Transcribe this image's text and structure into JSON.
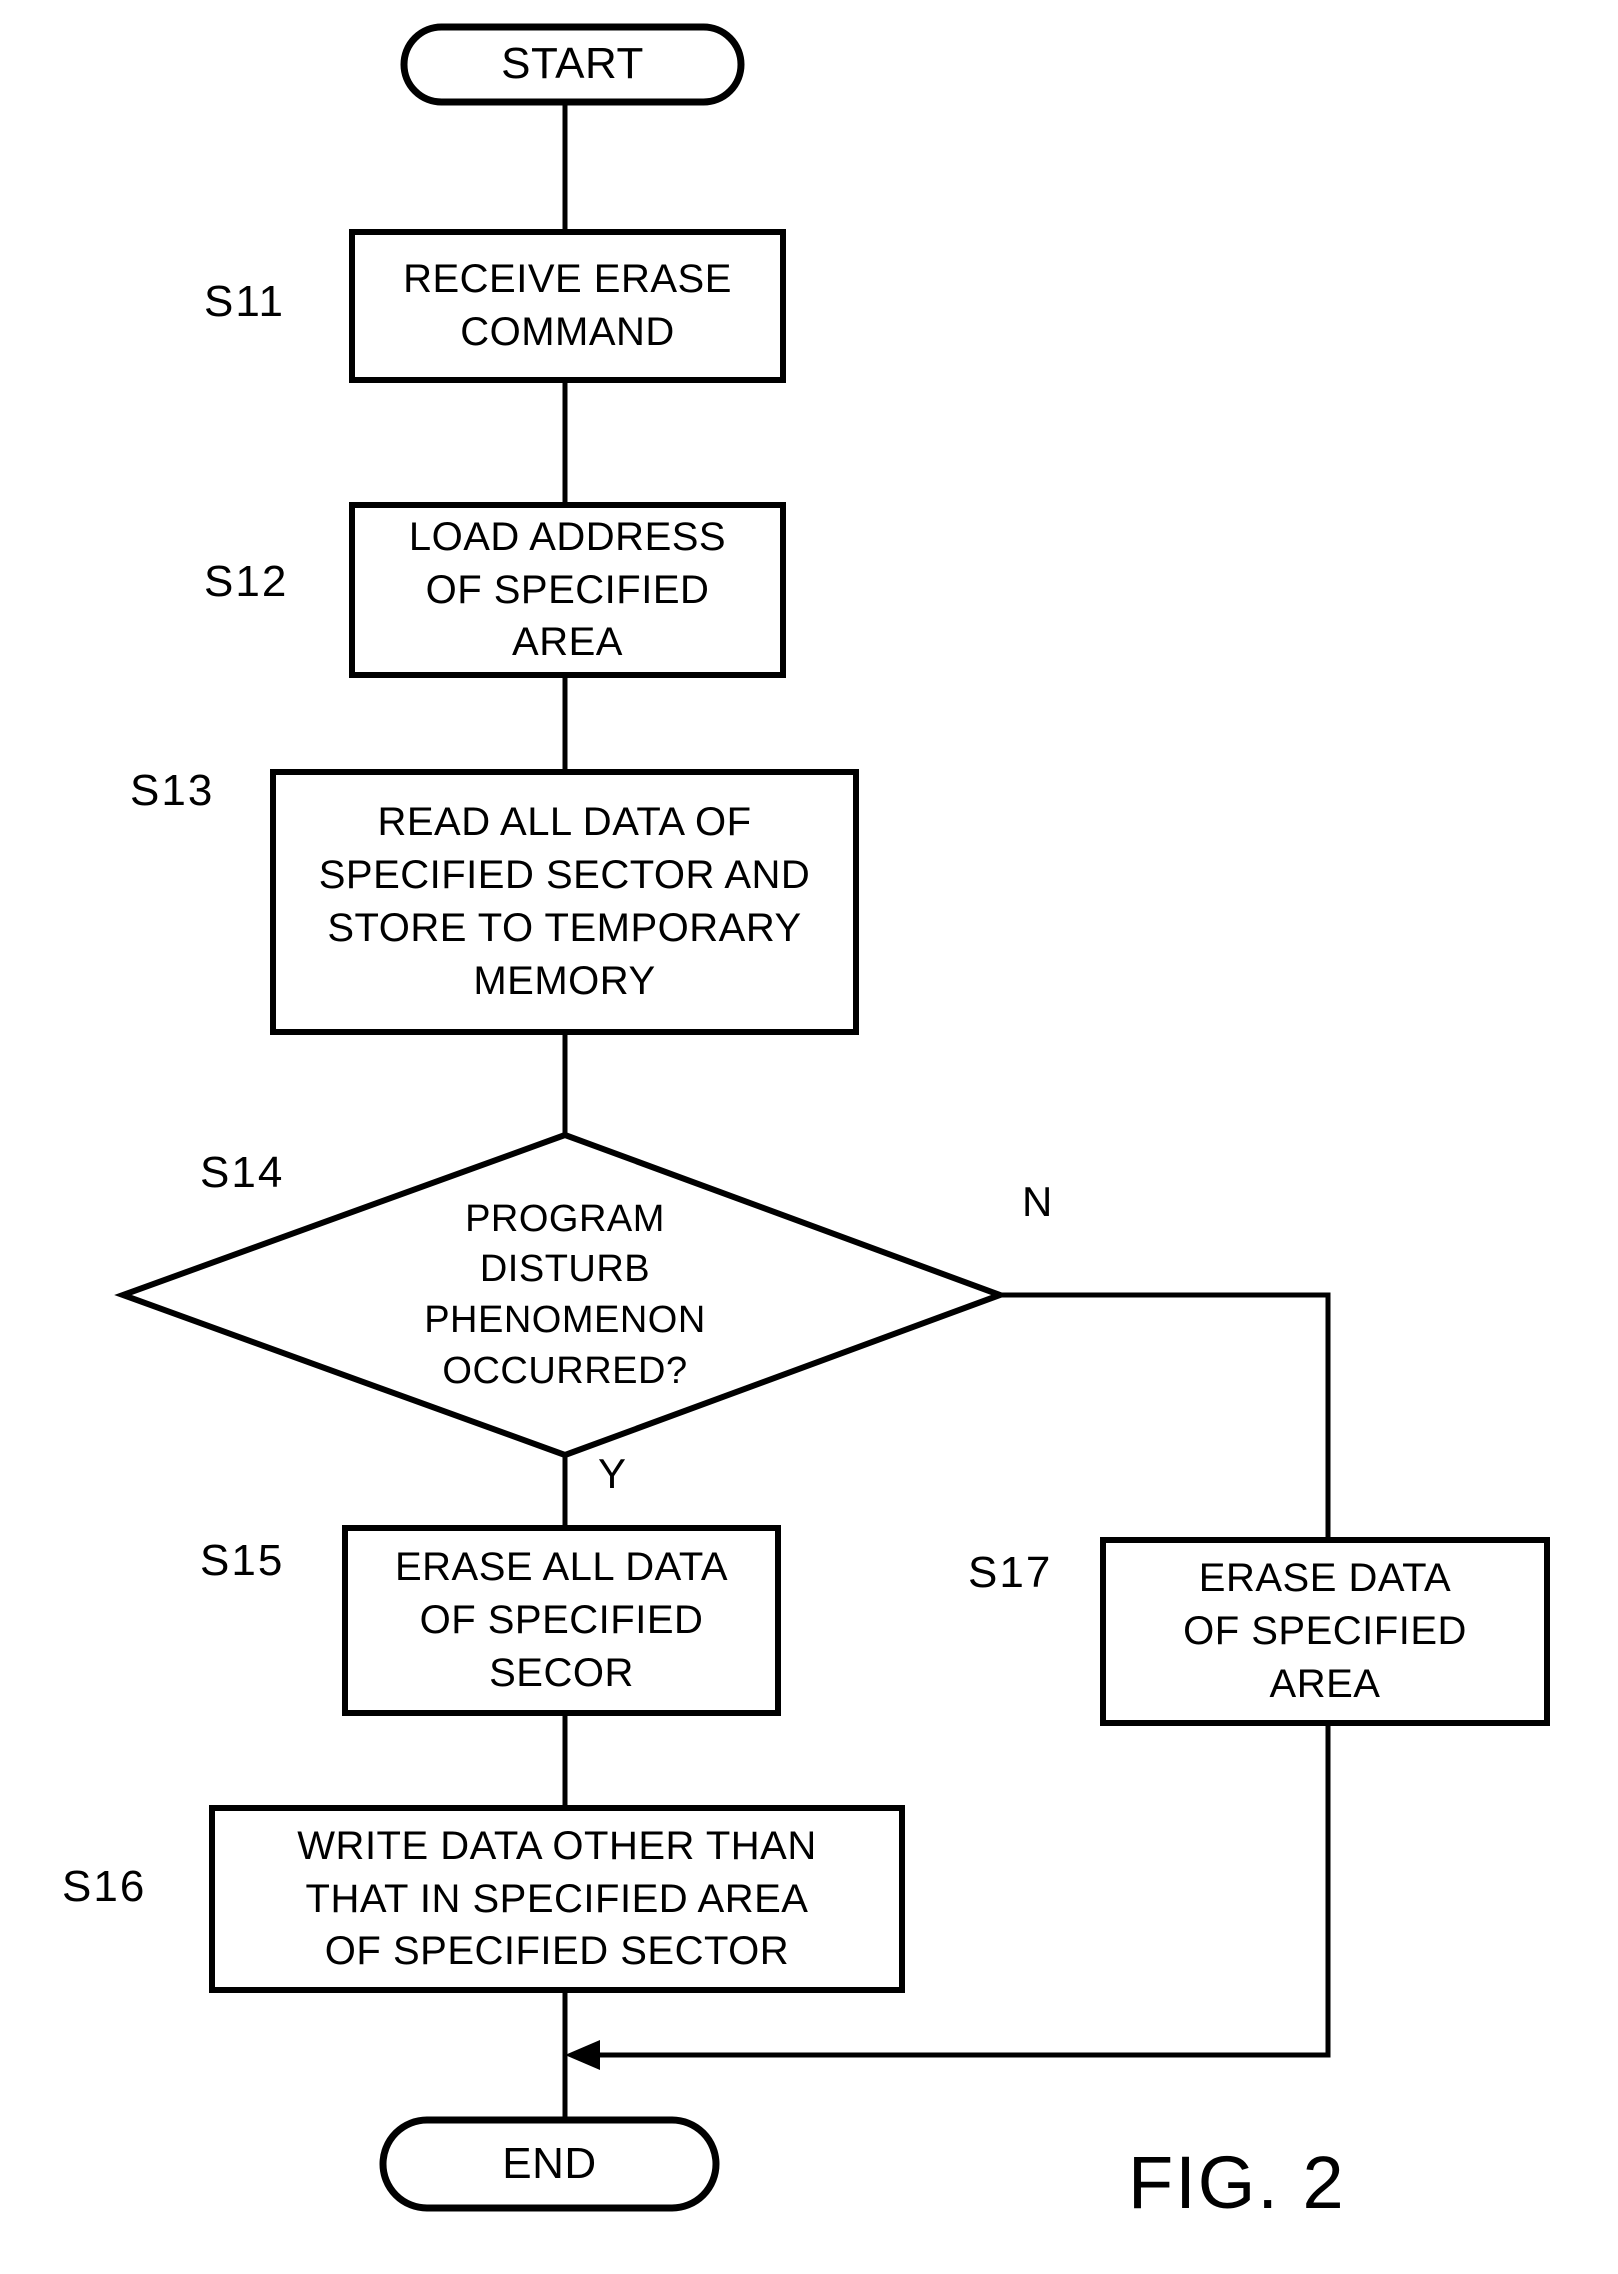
{
  "figure": {
    "caption": "FIG. 2",
    "type": "flowchart"
  },
  "nodes": {
    "start": {
      "label": "START",
      "shape": "terminal"
    },
    "end": {
      "label": "END",
      "shape": "terminal"
    },
    "s11": {
      "step": "S11",
      "shape": "process",
      "lines": [
        "RECEIVE ERASE",
        "COMMAND"
      ]
    },
    "s12": {
      "step": "S12",
      "shape": "process",
      "lines": [
        "LOAD ADDRESS",
        "OF SPECIFIED",
        "AREA"
      ]
    },
    "s13": {
      "step": "S13",
      "shape": "process",
      "lines": [
        "READ ALL DATA OF",
        "SPECIFIED SECTOR AND",
        "STORE TO TEMPORARY",
        "MEMORY"
      ]
    },
    "s14": {
      "step": "S14",
      "shape": "decision",
      "lines": [
        "PROGRAM",
        "DISTURB",
        "PHENOMENON",
        "OCCURRED?"
      ]
    },
    "s15": {
      "step": "S15",
      "shape": "process",
      "lines": [
        "ERASE ALL DATA",
        "OF SPECIFIED",
        "SECOR"
      ]
    },
    "s16": {
      "step": "S16",
      "shape": "process",
      "lines": [
        "WRITE DATA OTHER THAN",
        "THAT IN SPECIFIED AREA",
        "OF SPECIFIED SECTOR"
      ]
    },
    "s17": {
      "step": "S17",
      "shape": "process",
      "lines": [
        "ERASE DATA",
        "OF SPECIFIED",
        "AREA"
      ]
    }
  },
  "branches": {
    "yes": "Y",
    "no": "N"
  },
  "colors": {
    "stroke": "#000000",
    "background": "#ffffff",
    "text": "#000000"
  }
}
